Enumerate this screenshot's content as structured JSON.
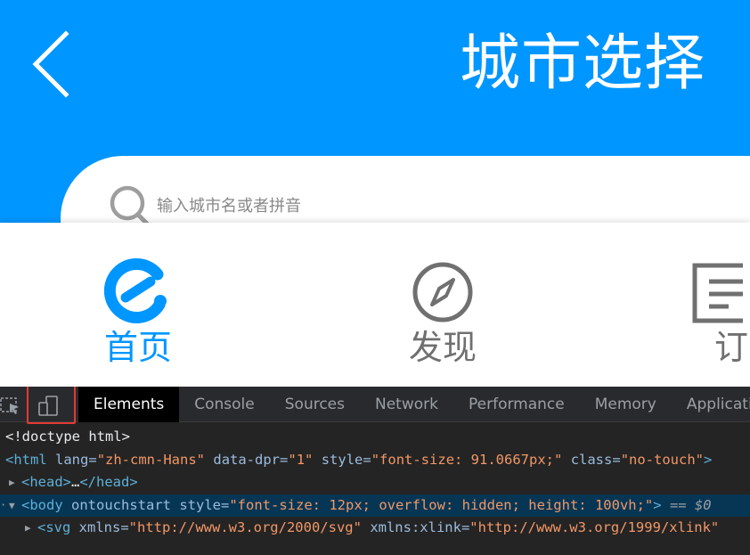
{
  "page": {
    "title": "城市选择",
    "search_placeholder": "输入城市名或者拼音"
  },
  "tabbar": {
    "items": [
      {
        "label": "首页",
        "icon": "eleme-logo-icon",
        "active": true
      },
      {
        "label": "发现",
        "icon": "compass-icon",
        "active": false
      },
      {
        "label": "订",
        "icon": "order-list-icon",
        "active": false
      }
    ]
  },
  "devtools": {
    "tabs": [
      "Elements",
      "Console",
      "Sources",
      "Network",
      "Performance",
      "Memory",
      "Application"
    ],
    "active_tab": "Elements",
    "dom": {
      "doctype": "<!doctype html>",
      "html_tag": "<html",
      "html_lang_attr": "lang=",
      "html_lang_val": "\"zh-cmn-Hans\"",
      "html_dpr_attr": "data-dpr=",
      "html_dpr_val": "\"1\"",
      "html_style_attr": "style=",
      "html_style_val": "\"font-size: 91.0667px;\"",
      "html_class_attr": "class=",
      "html_class_val": "\"no-touch\"",
      "html_close": ">",
      "head_open": "<head>",
      "head_ellipsis": "…",
      "head_close": "</head>",
      "body_tag": "<body",
      "body_ontouch_attr": "ontouchstart",
      "body_style_attr": "style=",
      "body_style_val": "\"font-size: 12px; overflow: hidden; height: 100vh;\"",
      "body_close": ">",
      "body_eq": "==",
      "body_dollar": "$0",
      "svg_tag": "<svg",
      "svg_xmlns_attr": "xmlns=",
      "svg_xmlns_val": "\"http://www.w3.org/2000/svg\"",
      "svg_xlink_attr": "xmlns:xlink=",
      "svg_xlink_val": "\"http://www.w3.org/1999/xlink\""
    }
  },
  "colors": {
    "brand_blue": "#0096ff",
    "devtools_bg": "#242424",
    "selection_bg": "#073655",
    "device_highlight": "#e53935"
  }
}
